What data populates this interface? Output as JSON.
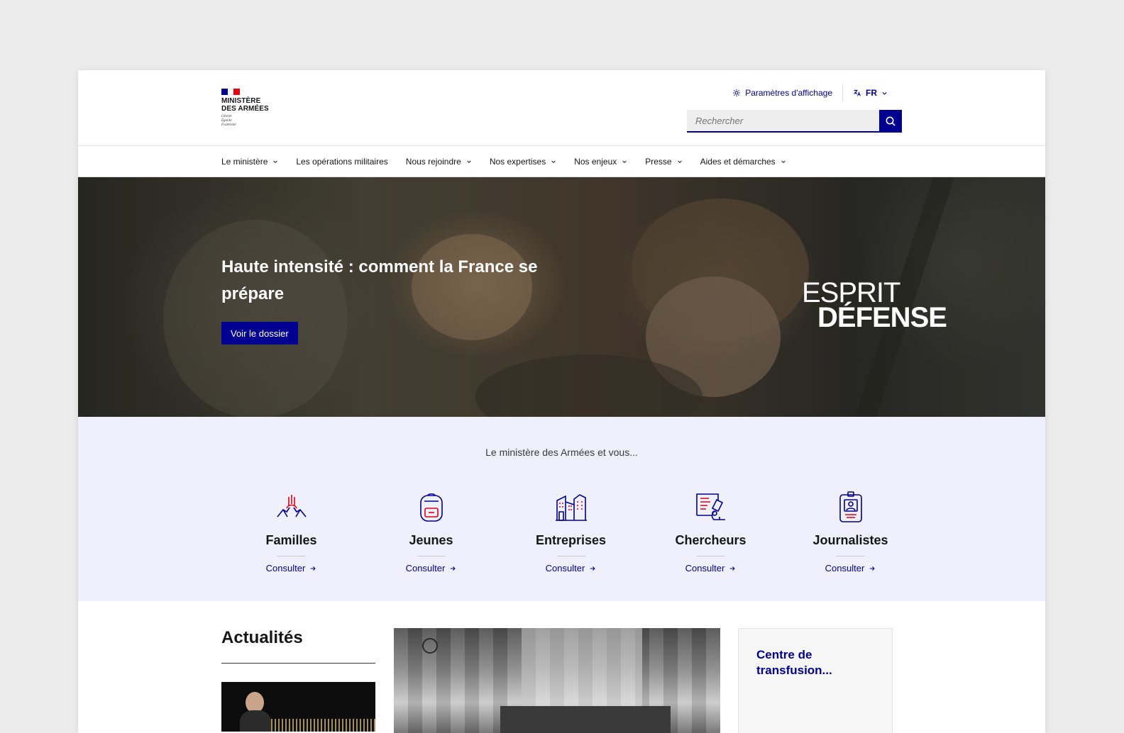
{
  "colors": {
    "primary": "#000091",
    "flag_blue": "#000091",
    "flag_white": "#ffffff",
    "flag_red": "#e1000f",
    "accent_red": "#e1000f",
    "audience_bg": "#f0f0fc"
  },
  "logo": {
    "line1": "MINISTÈRE",
    "line2": "DES ARMÉES",
    "motto": [
      "Liberté",
      "Égalité",
      "Fraternité"
    ]
  },
  "tools": {
    "display_settings": {
      "label": "Paramètres d'affichage",
      "icon": "sun-icon"
    },
    "language": {
      "label": "FR",
      "icon": "translate-icon"
    }
  },
  "search": {
    "placeholder": "Rechercher",
    "icon": "search-icon"
  },
  "nav": {
    "items": [
      {
        "label": "Le ministère",
        "has_dropdown": true
      },
      {
        "label": "Les opérations militaires",
        "has_dropdown": false
      },
      {
        "label": "Nous rejoindre",
        "has_dropdown": true
      },
      {
        "label": "Nos expertises",
        "has_dropdown": true
      },
      {
        "label": "Nos enjeux",
        "has_dropdown": true
      },
      {
        "label": "Presse",
        "has_dropdown": true
      },
      {
        "label": "Aides et démarches",
        "has_dropdown": true
      }
    ]
  },
  "hero": {
    "title": "Haute intensité : comment la France se prépare",
    "button": "Voir le dossier",
    "brand_line1": "ESPRIT",
    "brand_line2": "DÉFENSE"
  },
  "audience": {
    "title": "Le ministère des Armées et vous...",
    "items": [
      {
        "label": "Familles",
        "link": "Consulter",
        "icon": "hands-icon"
      },
      {
        "label": "Jeunes",
        "link": "Consulter",
        "icon": "backpack-icon"
      },
      {
        "label": "Entreprises",
        "link": "Consulter",
        "icon": "buildings-icon"
      },
      {
        "label": "Chercheurs",
        "link": "Consulter",
        "icon": "microscope-icon"
      },
      {
        "label": "Journalistes",
        "link": "Consulter",
        "icon": "press-badge-icon"
      }
    ]
  },
  "news": {
    "title": "Actualités",
    "card_title": "Centre de transfusion..."
  }
}
